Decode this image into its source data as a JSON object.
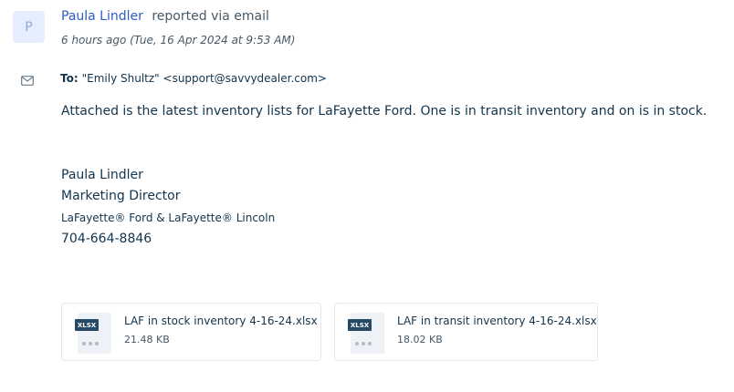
{
  "message": {
    "avatar_initial": "P",
    "sender_name": "Paula Lindler",
    "via_text": "reported via email",
    "timestamp": "6 hours ago (Tue, 16 Apr 2024 at 9:53 AM)",
    "to_label": "To:",
    "to_value": "\"Emily Shultz\" <support@savvydealer.com>",
    "body": "Attached is the latest inventory lists for LaFayette Ford. One is in transit inventory and on is in stock.",
    "signature": {
      "name": "Paula Lindler",
      "title": "Marketing Director",
      "company": "LaFayette® Ford & LaFayette® Lincoln",
      "phone": "704-664-8846"
    }
  },
  "attachments": [
    {
      "badge": "XLSX",
      "name": "LAF in stock inventory 4-16-24.xlsx",
      "size": "21.48 KB"
    },
    {
      "badge": "XLSX",
      "name": "LAF in transit inventory 4-16-24.xlsx",
      "size": "18.02 KB"
    }
  ],
  "icons": {
    "avatar": "avatar-initial",
    "channel": "envelope-icon",
    "file": "xlsx-file-icon"
  },
  "colors": {
    "link": "#2c5cc5",
    "text": "#12344d",
    "muted": "#475867",
    "avatar_bg": "#e5eefe",
    "badge": "#264966"
  }
}
